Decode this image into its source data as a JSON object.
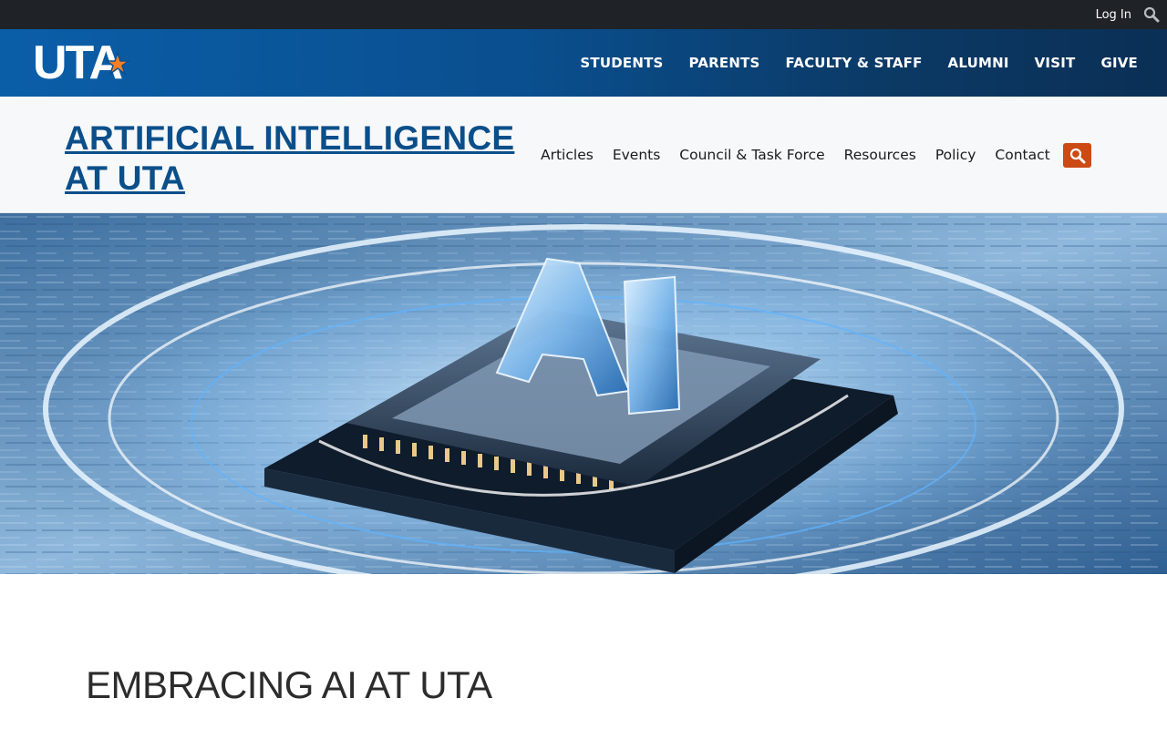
{
  "utility": {
    "login_label": "Log In",
    "search_icon": "search-icon"
  },
  "brand": {
    "logo_text": "UTA",
    "logo_star_color": "#f58025",
    "nav": [
      {
        "label": "STUDENTS"
      },
      {
        "label": "PARENTS"
      },
      {
        "label": "FACULTY & STAFF"
      },
      {
        "label": "ALUMNI"
      },
      {
        "label": "VISIT"
      },
      {
        "label": "GIVE"
      }
    ]
  },
  "site": {
    "title_line1": "ARTIFICIAL INTELLIGENCE",
    "title_line2": "AT UTA",
    "nav": [
      {
        "label": "Articles"
      },
      {
        "label": "Events"
      },
      {
        "label": "Council & Task Force"
      },
      {
        "label": "Resources"
      },
      {
        "label": "Policy"
      },
      {
        "label": "Contact"
      }
    ],
    "search_icon": "search-icon",
    "search_button_color": "#cc4a14"
  },
  "hero": {
    "image": "ai-chip-hero-image",
    "chip_letters": "AI"
  },
  "content": {
    "heading": "EMBRACING AI AT UTA"
  },
  "colors": {
    "utility_bar": "#1f2226",
    "brand_blue": "#0a5ea8",
    "title_blue": "#0b4f8a",
    "accent_orange": "#cc4a14"
  }
}
